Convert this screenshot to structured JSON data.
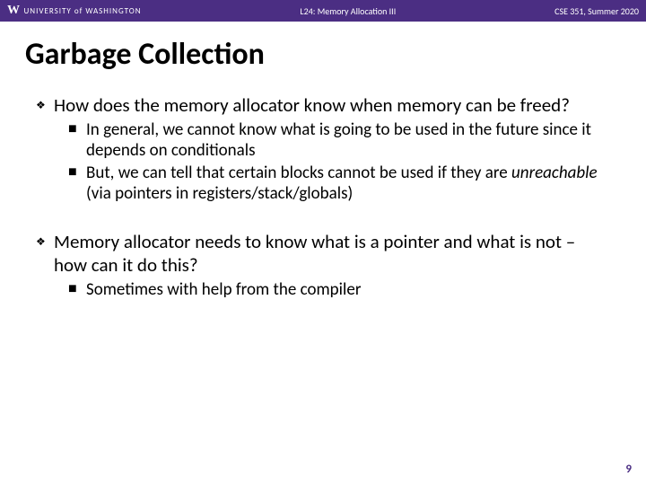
{
  "header": {
    "logo_letter": "W",
    "university": "UNIVERSITY of WASHINGTON",
    "lecture": "L24: Memory Allocation III",
    "course": "CSE 351, Summer 2020"
  },
  "title": "Garbage Collection",
  "bullets": [
    {
      "text": "How does the memory allocator know when memory can be freed?",
      "sub": [
        {
          "text": "In general, we cannot know what is going to be used in the future since it depends on conditionals"
        },
        {
          "prefix": "But, we can tell that certain blocks cannot be used if they are ",
          "italic": "unreachable",
          "suffix": " (via pointers in registers/stack/globals)"
        }
      ]
    },
    {
      "text": "Memory allocator needs to know what is a pointer and what is not – how can it do this?",
      "sub": [
        {
          "text": "Sometimes with help from the compiler"
        }
      ]
    }
  ],
  "page_number": "9"
}
